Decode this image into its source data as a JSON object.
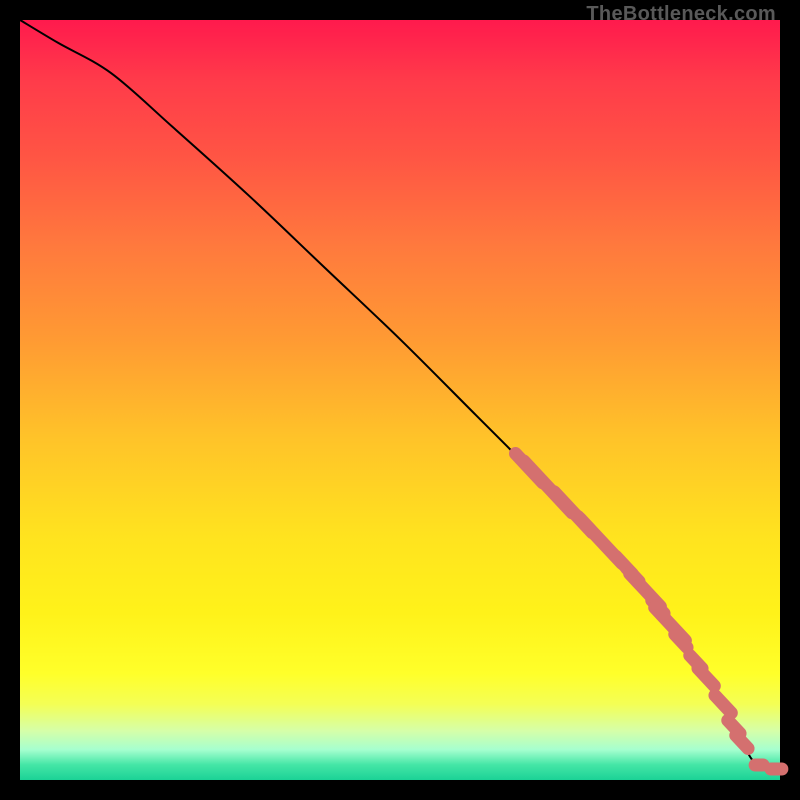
{
  "watermark": "TheBottleneck.com",
  "colors": {
    "marker": "#d4706f",
    "curve": "#000000"
  },
  "chart_data": {
    "type": "line",
    "x": [
      0,
      5,
      12,
      20,
      30,
      40,
      50,
      60,
      67,
      75,
      82,
      88,
      92,
      95,
      97,
      100
    ],
    "y": [
      100,
      97,
      93,
      86,
      77,
      67.5,
      58,
      48,
      41,
      33,
      25,
      17,
      11,
      5,
      2,
      1.5
    ],
    "xlim": [
      0,
      100
    ],
    "ylim": [
      0,
      100
    ],
    "markers": [
      {
        "x": 67.0,
        "y": 41.0,
        "len": 4.0
      },
      {
        "x": 69.5,
        "y": 38.5,
        "len": 7.0
      },
      {
        "x": 72.8,
        "y": 35.2,
        "len": 5.5
      },
      {
        "x": 74.2,
        "y": 33.8,
        "len": 2.0
      },
      {
        "x": 76.5,
        "y": 31.5,
        "len": 6.0
      },
      {
        "x": 79.5,
        "y": 28.3,
        "len": 2.5
      },
      {
        "x": 80.7,
        "y": 27.0,
        "len": 2.0
      },
      {
        "x": 82.3,
        "y": 25.0,
        "len": 4.5
      },
      {
        "x": 84.0,
        "y": 22.7,
        "len": 2.0
      },
      {
        "x": 85.5,
        "y": 20.5,
        "len": 4.5
      },
      {
        "x": 87.0,
        "y": 18.3,
        "len": 2.0
      },
      {
        "x": 89.0,
        "y": 15.5,
        "len": 2.0
      },
      {
        "x": 90.2,
        "y": 13.5,
        "len": 2.5
      },
      {
        "x": 92.5,
        "y": 10.0,
        "len": 2.5
      },
      {
        "x": 94.0,
        "y": 7.0,
        "len": 2.0
      },
      {
        "x": 95.0,
        "y": 5.0,
        "len": 2.0
      },
      {
        "x": 97.3,
        "y": 2.0,
        "len": 1.5
      },
      {
        "x": 99.5,
        "y": 1.5,
        "len": 1.8
      }
    ],
    "title": "",
    "xlabel": "",
    "ylabel": "",
    "grid": false,
    "legend": false
  }
}
